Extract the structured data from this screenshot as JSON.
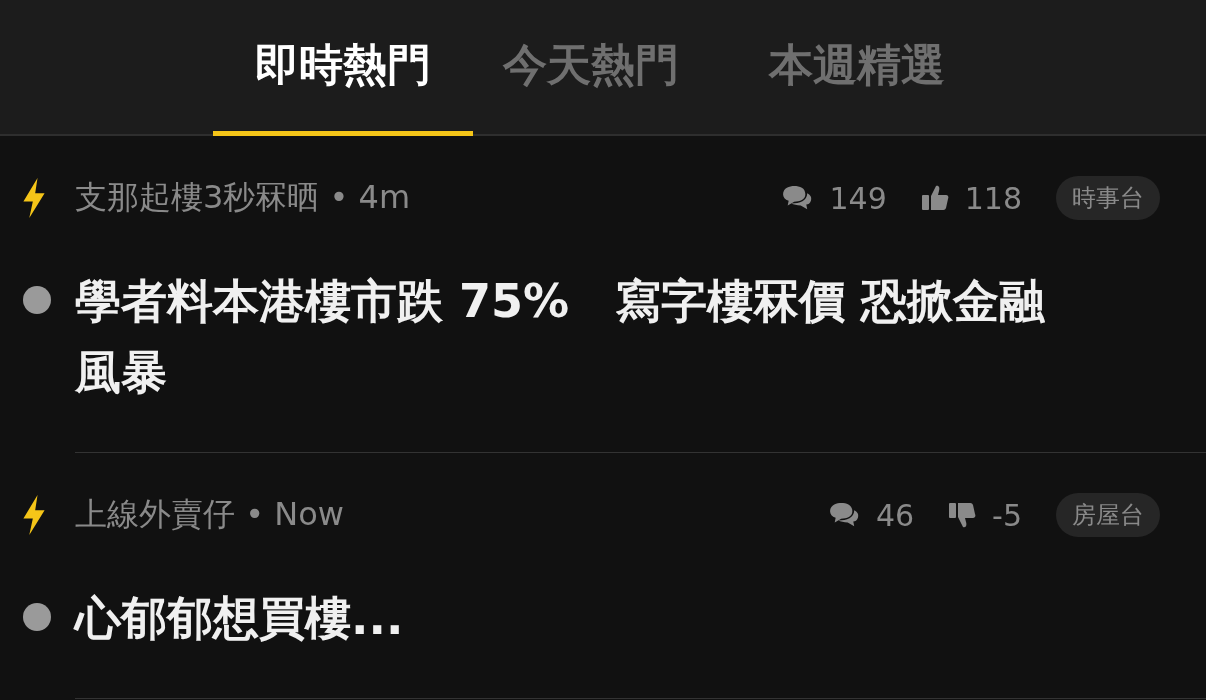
{
  "tabs": [
    {
      "label": "即時熱門",
      "selected": true
    },
    {
      "label": "今天熱門",
      "selected": false
    },
    {
      "label": "本週精選",
      "selected": false
    }
  ],
  "posts": [
    {
      "author": "支那起樓3秒冧晒",
      "separator": "•",
      "time": "4m",
      "comments": "149",
      "vote": {
        "kind": "up",
        "count": "118"
      },
      "tag": "時事台",
      "title": "學者料本港樓市跌 75%　寫字樓冧價 恐掀金融風暴",
      "read": false
    },
    {
      "author": "上線外賣仔",
      "separator": "•",
      "time": "Now",
      "comments": "46",
      "vote": {
        "kind": "down",
        "count": "-5"
      },
      "tag": "房屋台",
      "title": "心郁郁想買樓...",
      "read": false
    }
  ]
}
